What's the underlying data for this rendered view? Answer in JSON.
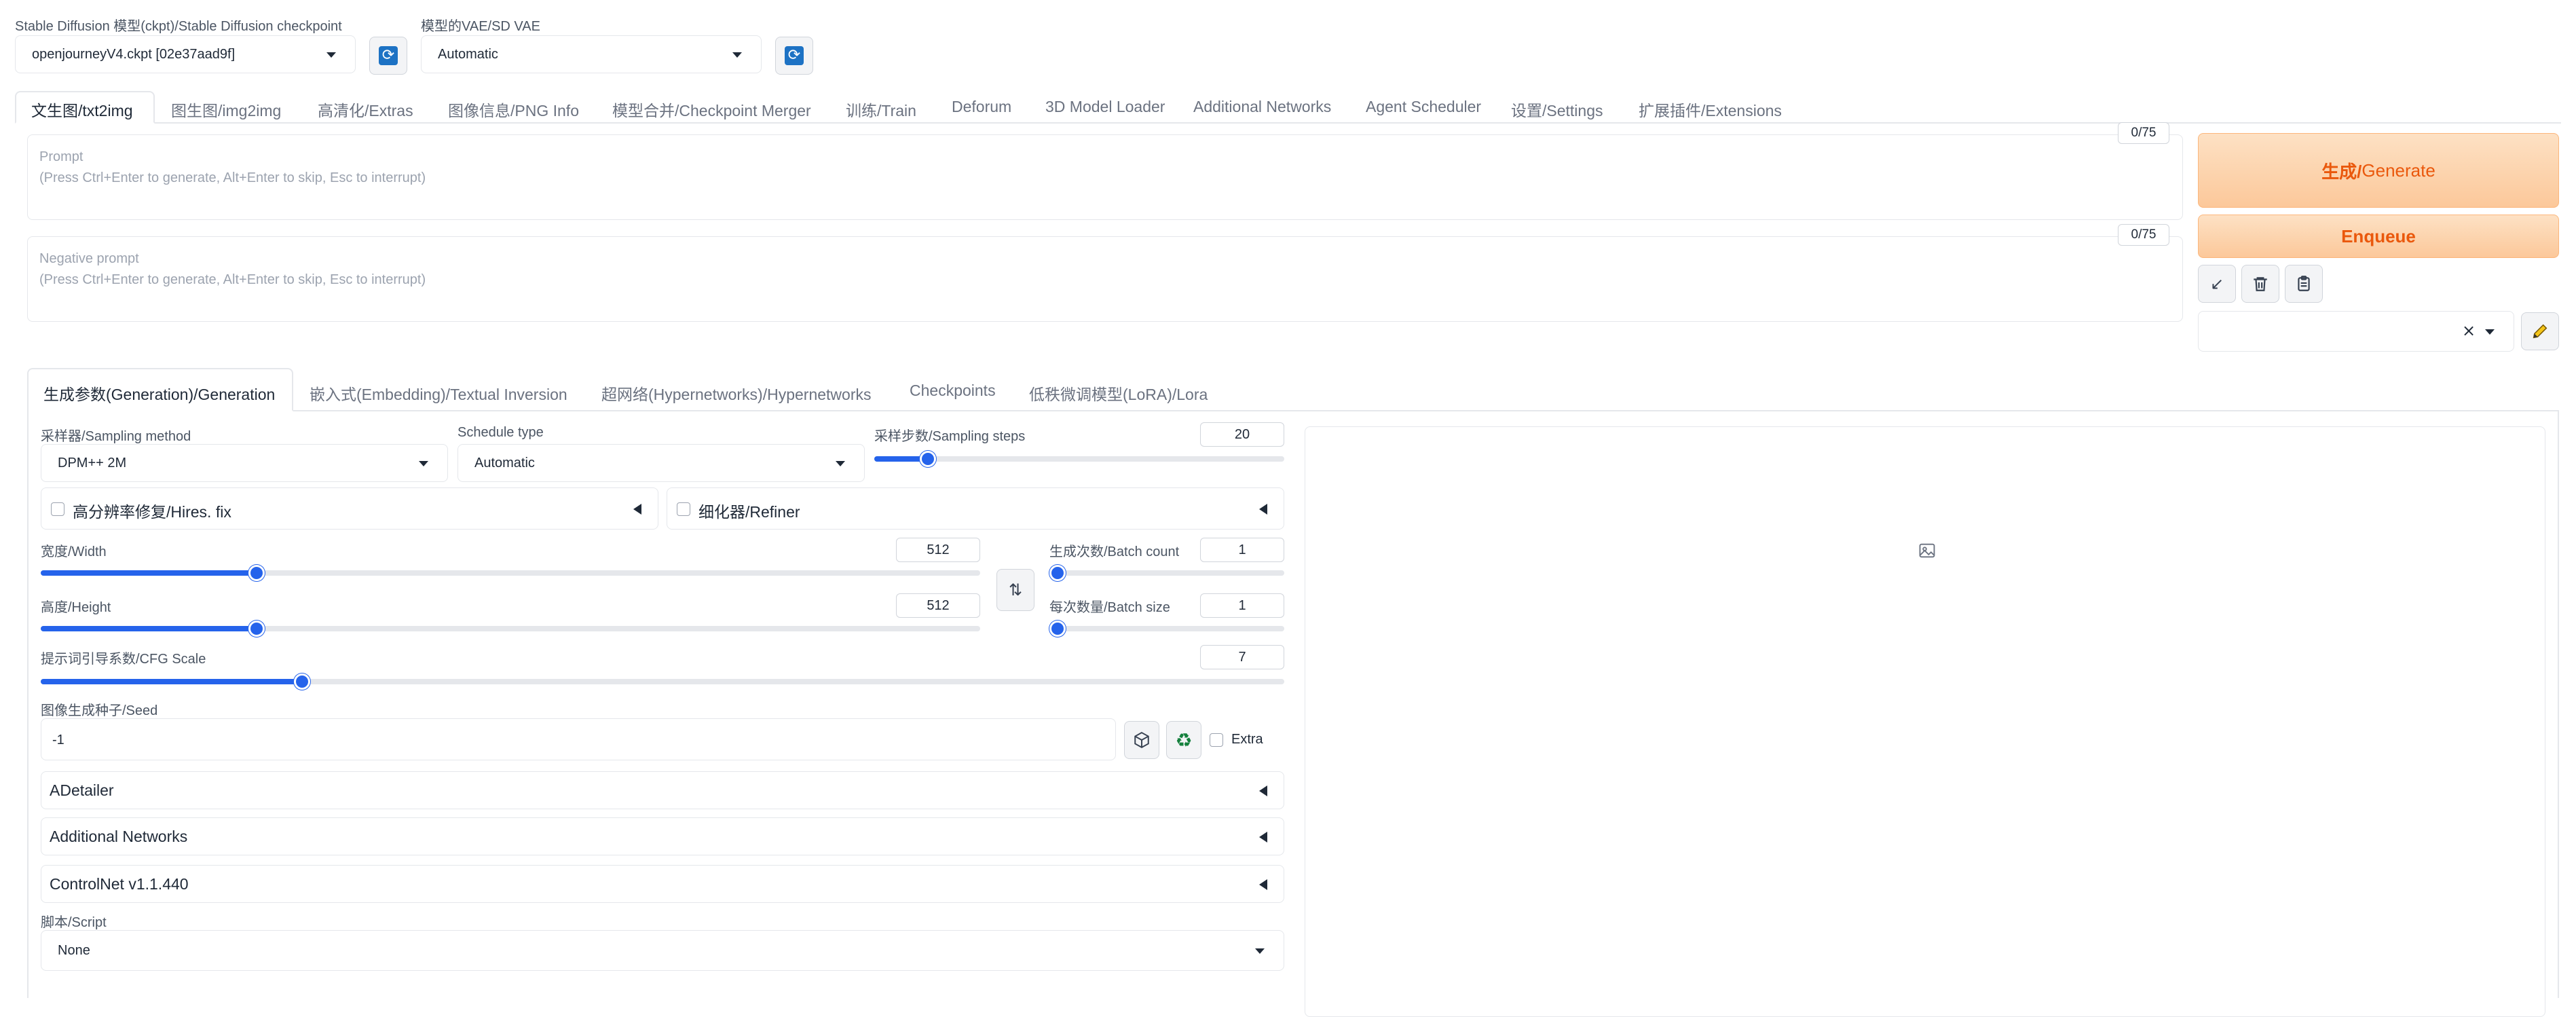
{
  "checkpoint": {
    "label": "Stable Diffusion 模型(ckpt)/Stable Diffusion checkpoint",
    "value": "openjourneyV4.ckpt [02e37aad9f]",
    "refresh_icon": "refresh-icon"
  },
  "vae": {
    "label": "模型的VAE/SD VAE",
    "value": "Automatic",
    "refresh_icon": "refresh-icon"
  },
  "main_tabs": [
    {
      "label": "文生图/txt2img",
      "active": true
    },
    {
      "label": "图生图/img2img"
    },
    {
      "label": "高清化/Extras"
    },
    {
      "label": "图像信息/PNG Info"
    },
    {
      "label": "模型合并/Checkpoint Merger"
    },
    {
      "label": "训练/Train"
    },
    {
      "label": "Deforum"
    },
    {
      "label": "3D Model Loader"
    },
    {
      "label": "Additional Networks"
    },
    {
      "label": "Agent Scheduler"
    },
    {
      "label": "设置/Settings"
    },
    {
      "label": "扩展插件/Extensions"
    }
  ],
  "prompt": {
    "label": "Prompt",
    "placeholder": "(Press Ctrl+Enter to generate, Alt+Enter to skip, Esc to interrupt)",
    "counter": "0/75"
  },
  "negative_prompt": {
    "label": "Negative prompt",
    "placeholder": "(Press Ctrl+Enter to generate, Alt+Enter to skip, Esc to interrupt)",
    "counter": "0/75"
  },
  "actions": {
    "generate_cn": "生成/",
    "generate_en": "Generate",
    "enqueue": "Enqueue",
    "tool_icons": [
      "arrow-down-left-icon",
      "trash-icon",
      "clipboard-icon"
    ],
    "style_clear": "×",
    "edit_icon": "pencil-icon",
    "accent_color": "#ea580c"
  },
  "sub_tabs": [
    {
      "label": "生成参数(Generation)/Generation",
      "active": true
    },
    {
      "label": "嵌入式(Embedding)/Textual Inversion"
    },
    {
      "label": "超网络(Hypernetworks)/Hypernetworks"
    },
    {
      "label": "Checkpoints"
    },
    {
      "label": "低秩微调模型(LoRA)/Lora"
    }
  ],
  "sampling": {
    "method_label": "采样器/Sampling method",
    "method_value": "DPM++ 2M",
    "schedule_label": "Schedule type",
    "schedule_value": "Automatic",
    "steps_label": "采样步数/Sampling steps",
    "steps_value": "20",
    "steps_fraction": 0.13
  },
  "hires_fix": {
    "label": "高分辨率修复/Hires. fix"
  },
  "refiner": {
    "label": "细化器/Refiner"
  },
  "width": {
    "label": "宽度/Width",
    "value": "512",
    "fraction": 0.23
  },
  "height": {
    "label": "高度/Height",
    "value": "512",
    "fraction": 0.23
  },
  "swap_icon": "swap-vertical-icon",
  "batch_count": {
    "label": "生成次数/Batch count",
    "value": "1",
    "fraction": 0.0
  },
  "batch_size": {
    "label": "每次数量/Batch size",
    "value": "1",
    "fraction": 0.0
  },
  "cfg": {
    "label": "提示词引导系数/CFG Scale",
    "value": "7",
    "fraction": 0.21
  },
  "seed": {
    "label": "图像生成种子/Seed",
    "value": "-1",
    "dice_icon": "dice-icon",
    "recycle_icon": "recycle-icon",
    "extra_label": "Extra"
  },
  "accordions": [
    {
      "label": "ADetailer"
    },
    {
      "label": "Additional Networks"
    },
    {
      "label": "ControlNet v1.1.440"
    }
  ],
  "script": {
    "label": "脚本/Script",
    "value": "None"
  },
  "output": {
    "placeholder_icon": "image-icon"
  }
}
